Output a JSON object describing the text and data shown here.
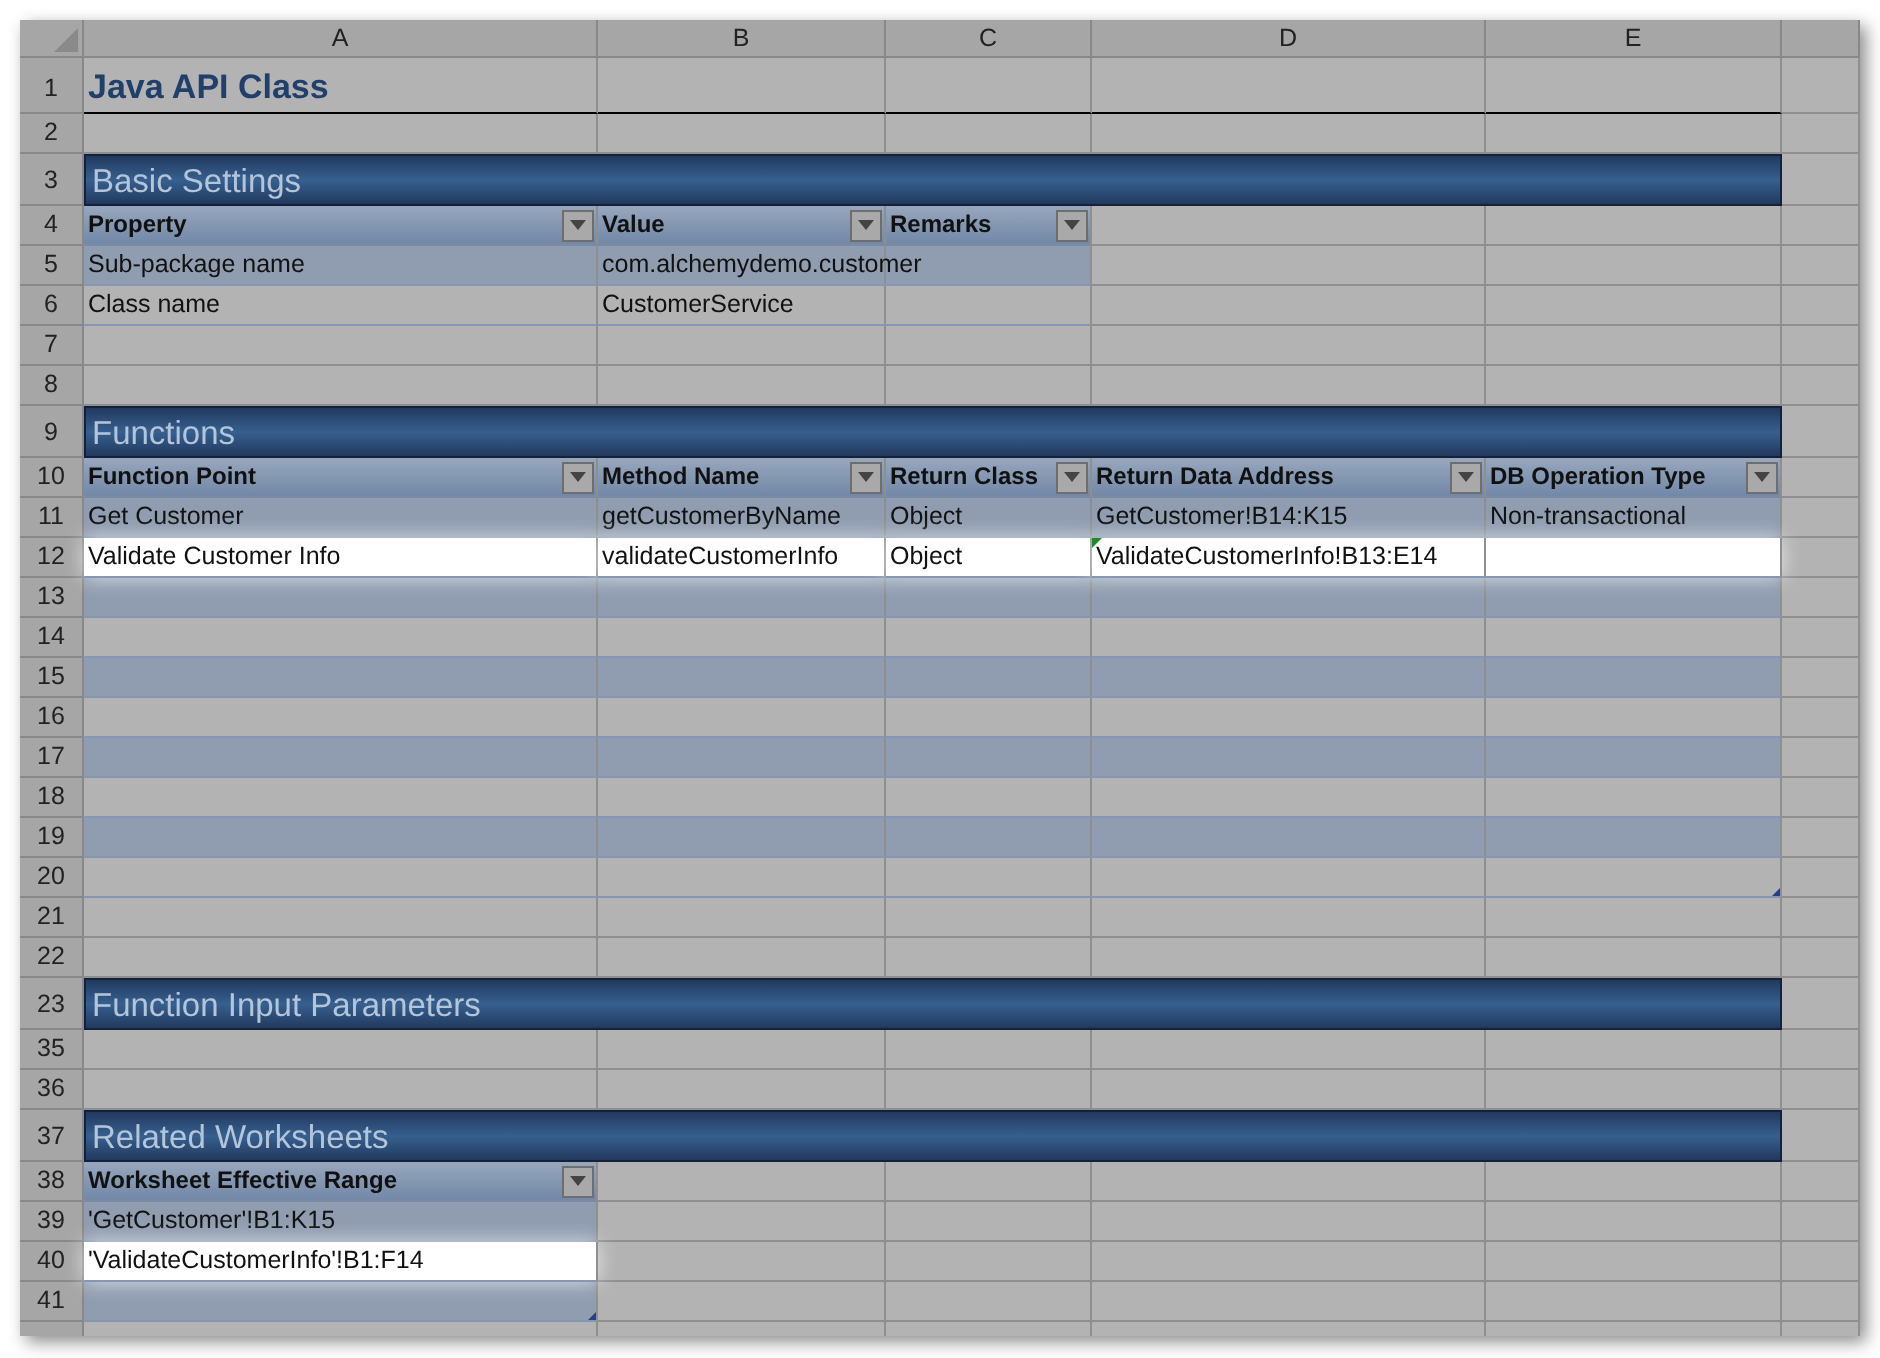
{
  "sheet": {
    "column_headers": [
      {
        "label": "A"
      },
      {
        "label": "B"
      },
      {
        "label": "C"
      },
      {
        "label": "D"
      },
      {
        "label": "E"
      }
    ],
    "rows": [
      {
        "number": "1",
        "kind": "title",
        "text": "Java API Class"
      },
      {
        "number": "2",
        "kind": "blank"
      },
      {
        "number": "3",
        "kind": "section",
        "text": "Basic Settings"
      },
      {
        "number": "4",
        "kind": "header",
        "cells": [
          "Property",
          "Value",
          "Remarks"
        ]
      },
      {
        "number": "5",
        "kind": "data",
        "banded": true,
        "highlighted": false,
        "cells": [
          {
            "text": "Sub-package name",
            "flagged": false
          },
          {
            "text": "com.alchemydemo.customer",
            "flagged": false
          }
        ]
      },
      {
        "number": "6",
        "kind": "data",
        "banded": false,
        "highlighted": false,
        "cells": [
          {
            "text": "Class name",
            "flagged": false
          },
          {
            "text": "CustomerService",
            "flagged": false
          }
        ]
      },
      {
        "number": "7",
        "kind": "blank"
      },
      {
        "number": "8",
        "kind": "blank"
      },
      {
        "number": "9",
        "kind": "section",
        "text": "Functions"
      },
      {
        "number": "10",
        "kind": "header",
        "cells": [
          "Function Point",
          "Method Name",
          "Return Class",
          "Return Data Address",
          "DB Operation Type"
        ]
      },
      {
        "number": "11",
        "kind": "data",
        "banded": true,
        "highlighted": false,
        "cells": [
          {
            "text": "Get Customer",
            "flagged": false
          },
          {
            "text": "getCustomerByName",
            "flagged": false
          },
          {
            "text": "Object",
            "flagged": false
          },
          {
            "text": "GetCustomer!B14:K15",
            "flagged": false
          },
          {
            "text": "Non-transactional",
            "flagged": false
          }
        ]
      },
      {
        "number": "12",
        "kind": "data",
        "banded": false,
        "highlighted": true,
        "cells": [
          {
            "text": "Validate Customer Info",
            "flagged": false
          },
          {
            "text": "validateCustomerInfo",
            "flagged": false
          },
          {
            "text": "Object",
            "flagged": false
          },
          {
            "text": "ValidateCustomerInfo!B13:E14",
            "flagged": true
          }
        ]
      },
      {
        "number": "13",
        "kind": "data",
        "banded": true,
        "highlighted": false
      },
      {
        "number": "14",
        "kind": "data",
        "banded": false,
        "highlighted": false
      },
      {
        "number": "15",
        "kind": "data",
        "banded": true,
        "highlighted": false
      },
      {
        "number": "16",
        "kind": "data",
        "banded": false,
        "highlighted": false
      },
      {
        "number": "17",
        "kind": "data",
        "banded": true,
        "highlighted": false
      },
      {
        "number": "18",
        "kind": "data",
        "banded": false,
        "highlighted": false
      },
      {
        "number": "19",
        "kind": "data",
        "banded": true,
        "highlighted": false
      },
      {
        "number": "20",
        "kind": "data",
        "banded": false,
        "highlighted": false
      },
      {
        "number": "21",
        "kind": "blank"
      },
      {
        "number": "22",
        "kind": "blank"
      },
      {
        "number": "23",
        "kind": "section",
        "text": "Function Input Parameters"
      },
      {
        "number": "35",
        "kind": "blank"
      },
      {
        "number": "36",
        "kind": "blank"
      },
      {
        "number": "37",
        "kind": "section",
        "text": "Related Worksheets"
      },
      {
        "number": "38",
        "kind": "header",
        "cells": [
          "Worksheet Effective Range"
        ]
      },
      {
        "number": "39",
        "kind": "data",
        "banded": true,
        "highlighted": false,
        "cells": [
          {
            "text": "'GetCustomer'!B1:K15",
            "flagged": false
          }
        ]
      },
      {
        "number": "40",
        "kind": "data",
        "banded": false,
        "highlighted": true,
        "cells": [
          {
            "text": "'ValidateCustomerInfo'!B1:F14",
            "flagged": false
          }
        ]
      },
      {
        "number": "41",
        "kind": "data",
        "banded": true,
        "highlighted": false
      },
      {
        "kind": "blank"
      }
    ]
  }
}
